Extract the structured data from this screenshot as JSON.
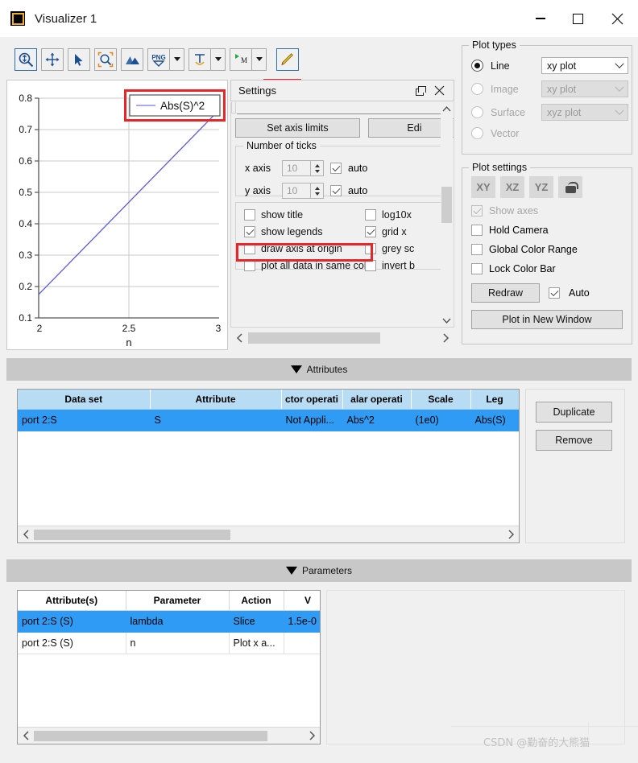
{
  "window": {
    "title": "Visualizer 1",
    "app_icon": "square-icon",
    "minimize": "minimize-icon",
    "maximize": "maximize-icon",
    "close": "close-icon"
  },
  "toolbar": {
    "buttons": [
      {
        "name": "zoom-in-icon",
        "label": "Zoom",
        "selected": true
      },
      {
        "name": "pan-icon",
        "label": "Pan",
        "selected": false
      },
      {
        "name": "cursor-icon",
        "label": "Select",
        "selected": false
      },
      {
        "name": "zoom-region-icon",
        "label": "Zoom region",
        "selected": false
      },
      {
        "name": "surface-icon",
        "label": "Surface",
        "selected": false
      },
      {
        "name": "png-export-icon",
        "label": "PNG",
        "selected": false,
        "has_dropdown": true
      },
      {
        "name": "text-annotation-icon",
        "label": "T",
        "selected": false,
        "has_dropdown": true
      },
      {
        "name": "marker-icon",
        "label": "M",
        "selected": false,
        "has_dropdown": true
      },
      {
        "name": "pencil-edit-icon",
        "label": "Edit",
        "selected": true,
        "highlighted": true
      }
    ]
  },
  "plot": {
    "legend_label": "Abs(S)^2",
    "legend_highlighted": true,
    "xlabel": "n",
    "ylabel": "",
    "line_color": "#5b5bd6"
  },
  "chart_data": {
    "type": "line",
    "title": "",
    "xlabel": "n",
    "ylabel": "",
    "xlim": [
      2,
      3
    ],
    "ylim": [
      0.1,
      0.8
    ],
    "xticks": [
      "2",
      "2.5",
      "3"
    ],
    "xtick_values": [
      2,
      2.5,
      3
    ],
    "yticks": [
      "0.1",
      "0.2",
      "0.3",
      "0.4",
      "0.5",
      "0.6",
      "0.7",
      "0.8"
    ],
    "ytick_values": [
      0.1,
      0.2,
      0.3,
      0.4,
      0.5,
      0.6,
      0.7,
      0.8
    ],
    "grid": true,
    "legend_position": "top-right",
    "series": [
      {
        "name": "Abs(S)^2",
        "color": "#5b5bd6",
        "x": [
          2.0,
          2.1,
          2.2,
          2.3,
          2.4,
          2.5,
          2.6,
          2.7,
          2.8,
          2.9,
          3.0
        ],
        "y": [
          0.175,
          0.234,
          0.293,
          0.352,
          0.41,
          0.469,
          0.528,
          0.587,
          0.645,
          0.704,
          0.76
        ]
      }
    ]
  },
  "settings": {
    "title": "Settings",
    "float_icon": "float-window-icon",
    "close_icon": "close-icon",
    "buttons": {
      "set_axis_limits": "Set axis limits",
      "edit": "Edi"
    },
    "ticks_group": "Number of ticks",
    "ticks": [
      {
        "axis": "x axis",
        "value": "10",
        "auto_label": "auto",
        "auto_checked": true
      },
      {
        "axis": "y axis",
        "value": "10",
        "auto_label": "auto",
        "auto_checked": true
      }
    ],
    "options_left": [
      {
        "label": "show title",
        "checked": false
      },
      {
        "label": "show legends",
        "checked": true,
        "highlighted": true
      },
      {
        "label": "draw axis at origin",
        "checked": false
      },
      {
        "label": "plot all data in same color",
        "checked": false
      }
    ],
    "options_right": [
      {
        "label": "log10x",
        "checked": false
      },
      {
        "label": "grid x",
        "checked": true
      },
      {
        "label": "grey sc",
        "checked": false
      },
      {
        "label": "invert b",
        "checked": false
      }
    ]
  },
  "plot_types": {
    "group_label": "Plot types",
    "rows": [
      {
        "label": "Line",
        "selected": true,
        "enabled": true,
        "combo": "xy plot",
        "combo_enabled": true
      },
      {
        "label": "Image",
        "selected": false,
        "enabled": false,
        "combo": "xy plot",
        "combo_enabled": false
      },
      {
        "label": "Surface",
        "selected": false,
        "enabled": false,
        "combo": "xyz plot",
        "combo_enabled": false
      },
      {
        "label": "Vector",
        "selected": false,
        "enabled": false,
        "combo": null,
        "combo_enabled": false
      }
    ]
  },
  "plot_settings": {
    "group_label": "Plot settings",
    "axis_buttons": [
      "XY",
      "XZ",
      "YZ"
    ],
    "lock_icon": "lock-icon",
    "checkboxes": [
      {
        "label": "Show axes",
        "checked": true,
        "enabled": false
      },
      {
        "label": "Hold Camera",
        "checked": false,
        "enabled": true
      },
      {
        "label": "Global Color Range",
        "checked": false,
        "enabled": true
      },
      {
        "label": "Lock Color Bar",
        "checked": false,
        "enabled": true
      }
    ],
    "redraw_label": "Redraw",
    "auto_label": "Auto",
    "auto_checked": true,
    "plot_new_window_label": "Plot in New Window"
  },
  "attributes": {
    "header_label": "Attributes",
    "collapse_icon": "triangle-down-icon",
    "columns": [
      "Data set",
      "Attribute",
      "ctor operati",
      "alar operati",
      "Scale",
      "Leg"
    ],
    "rows": [
      {
        "cells": [
          "port 2:S",
          "S",
          "Not Appli...",
          "Abs^2",
          "(1e0)",
          "Abs(S)"
        ],
        "selected": true
      }
    ],
    "side_buttons": [
      "Duplicate",
      "Remove"
    ]
  },
  "parameters": {
    "header_label": "Parameters",
    "collapse_icon": "triangle-down-icon",
    "columns": [
      "Attribute(s)",
      "Parameter",
      "Action",
      "V"
    ],
    "rows": [
      {
        "cells": [
          "port 2:S (S)",
          "lambda",
          "Slice",
          "1.5e-0"
        ],
        "selected": true
      },
      {
        "cells": [
          "port 2:S (S)",
          "n",
          "Plot x a...",
          ""
        ],
        "selected": false
      }
    ]
  },
  "watermark": "CSDN @勤奋的大熊猫"
}
